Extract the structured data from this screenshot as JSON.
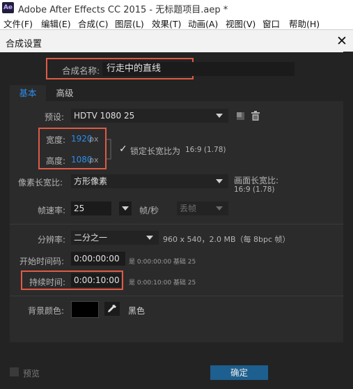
{
  "window": {
    "app_icon_text": "Ae",
    "title": "Adobe After Effects CC 2015 - 无标题项目.aep *"
  },
  "menu": [
    "文件(F)",
    "编辑(E)",
    "合成(C)",
    "图层(L)",
    "效果(T)",
    "动画(A)",
    "视图(V)",
    "窗口",
    "帮助(H)"
  ],
  "dialog": {
    "title": "合成设置",
    "close": "✕",
    "comp_name_label": "合成名称:",
    "comp_name_value": "行走中的直线",
    "tabs": [
      "基本",
      "高级"
    ],
    "preset_label": "预设:",
    "preset_value": "HDTV 1080 25",
    "width_label": "宽度:",
    "width_value": "1920",
    "height_label": "高度:",
    "height_value": "1080",
    "unit_px": "px",
    "lock_aspect_label": "锁定长宽比为",
    "lock_aspect_value": "16:9 (1.78)",
    "lock_checked": true,
    "pixel_aspect_label": "像素长宽比:",
    "pixel_aspect_value": "方形像素",
    "frame_aspect_label": "画面长宽比:",
    "frame_aspect_value": "16:9 (1.78)",
    "frame_rate_label": "帧速率:",
    "frame_rate_value": "25",
    "fps_unit": "帧/秒",
    "drop_frame": "丢帧",
    "resolution_label": "分辨率:",
    "resolution_value": "二分之一",
    "resolution_info": "960 x 540，2.0 MB（每 8bpc 帧）",
    "start_tc_label": "开始时间码:",
    "start_tc_value": "0:00:00:00",
    "start_tc_info": "是 0:00:00:00  基础 25",
    "duration_label": "持续时间:",
    "duration_value": "0:00:10:00",
    "duration_info": "是 0:00:10:00  基础 25",
    "bg_color_label": "背景颜色:",
    "bg_color_name": "黑色",
    "bg_color_hex": "#000000",
    "preview_label": "预览",
    "ok_label": "确定"
  }
}
